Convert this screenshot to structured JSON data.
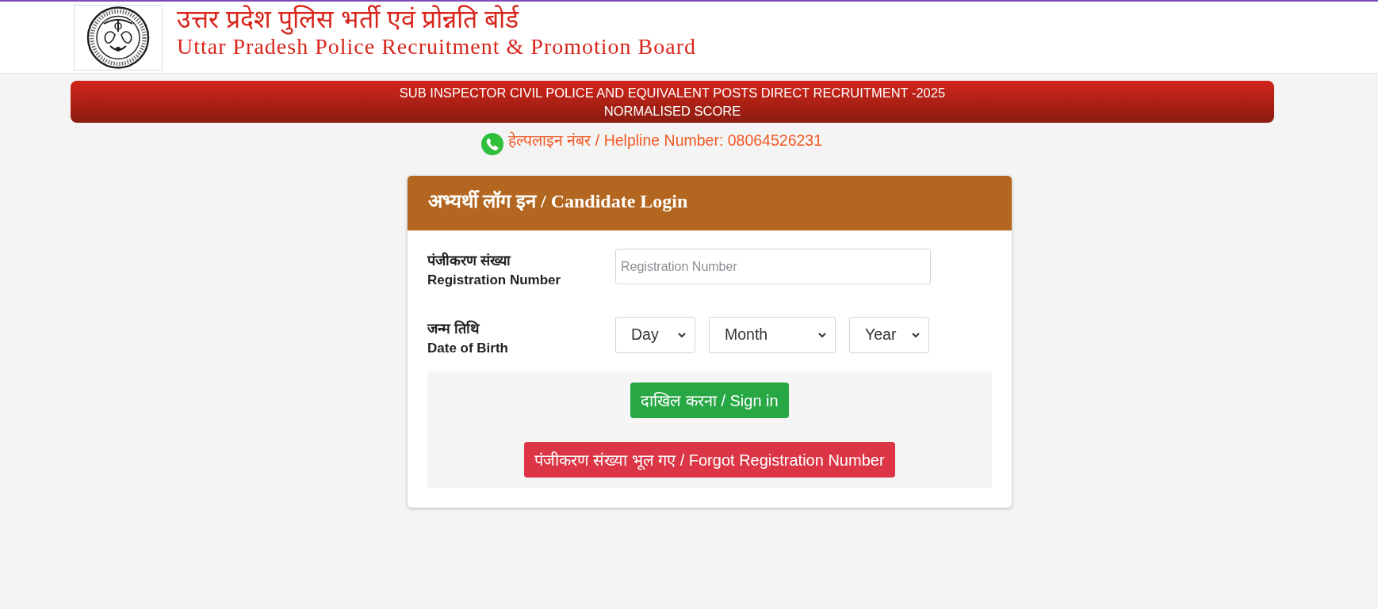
{
  "header": {
    "title_hindi": "उत्तर प्रदेश पुलिस भर्ती एवं प्रोन्नति बोर्ड",
    "title_english": "Uttar Pradesh Police Recruitment & Promotion Board"
  },
  "banner": {
    "lines": [
      "SUB INSPECTOR CIVIL POLICE AND EQUIVALENT POSTS DIRECT RECRUITMENT -2025",
      "NORMALISED SCORE"
    ]
  },
  "helpline": {
    "text": "हेल्पलाइन नंबर / Helpline Number: 08064526231"
  },
  "login": {
    "title": "अभ्यर्थी लॉग इन / Candidate Login",
    "fields": [
      {
        "kind": "text",
        "label_hindi": "पंजीकरण संख्या",
        "label_english": "Registration Number",
        "placeholder": "Registration Number"
      },
      {
        "kind": "date",
        "label_hindi": "जन्म तिथि",
        "label_english": "Date of Birth",
        "selects": [
          {
            "value": "Day"
          },
          {
            "value": "Month"
          },
          {
            "value": "Year"
          }
        ]
      }
    ],
    "buttons": [
      {
        "kind": "success",
        "label": "दाखिल करना / Sign in"
      },
      {
        "kind": "danger",
        "label": "पंजीकरण संख्या भूल गए / Forgot Registration Number"
      }
    ]
  }
}
